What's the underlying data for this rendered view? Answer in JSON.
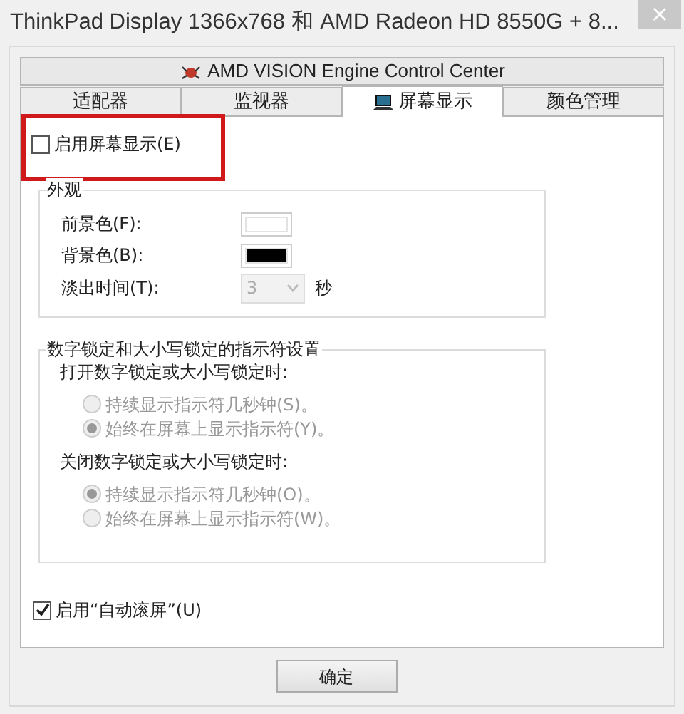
{
  "window": {
    "title": "ThinkPad Display 1366x768 和 AMD Radeon HD 8550G + 8...",
    "close": "×"
  },
  "header": {
    "title": "AMD VISION Engine Control Center"
  },
  "tabs": [
    {
      "label": "适配器",
      "selected": false
    },
    {
      "label": "监视器",
      "selected": false
    },
    {
      "label": "屏幕显示",
      "selected": true,
      "icon": true
    },
    {
      "label": "颜色管理",
      "selected": false
    }
  ],
  "enable_osd": {
    "label": "启用屏幕显示(E)",
    "checked": false,
    "highlighted": true
  },
  "appearance": {
    "legend": "外观",
    "foreground": {
      "label": "前景色(F):",
      "color": "#ffffff"
    },
    "background": {
      "label": "背景色(B):",
      "color": "#000000"
    },
    "fade": {
      "label": "淡出时间(T):",
      "value": "3",
      "unit": "秒",
      "disabled": true
    }
  },
  "indicator": {
    "legend": "数字锁定和大小写锁定的指示符设置",
    "groups": [
      {
        "heading": "打开数字锁定或大小写锁定时:",
        "options": [
          {
            "label": "持续显示指示符几秒钟(S)。",
            "selected": false,
            "disabled": true
          },
          {
            "label": "始终在屏幕上显示指示符(Y)。",
            "selected": true,
            "disabled": true
          }
        ]
      },
      {
        "heading": "关闭数字锁定或大小写锁定时:",
        "options": [
          {
            "label": "持续显示指示符几秒钟(O)。",
            "selected": true,
            "disabled": true
          },
          {
            "label": "始终在屏幕上显示指示符(W)。",
            "selected": false,
            "disabled": true
          }
        ]
      }
    ]
  },
  "auto_scroll": {
    "label": "启用“自动滚屏”(U)",
    "checked": true
  },
  "buttons": [
    {
      "label": "确定"
    }
  ]
}
